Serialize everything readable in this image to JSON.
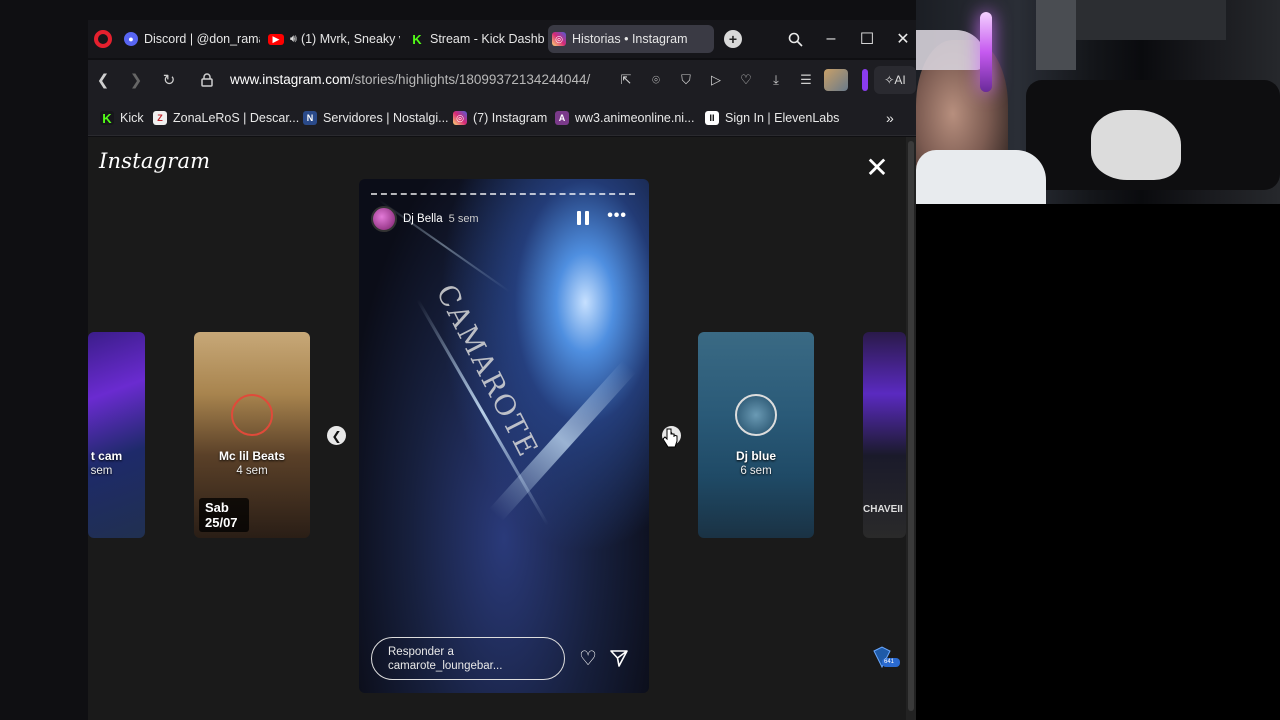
{
  "tabs": [
    {
      "label": "Discord | @don_rama",
      "icon": "discord-icon",
      "color": "#5865f2"
    },
    {
      "label": "(1) Mvrk, Sneaky v",
      "icon": "youtube-icon",
      "color": "#ff0000"
    },
    {
      "label": "Stream - Kick Dashbo",
      "icon": "kick-icon",
      "color": "#53fc18"
    },
    {
      "label": "Historias • Instagram",
      "icon": "instagram-icon",
      "color": "#d6249f",
      "active": true
    }
  ],
  "address": {
    "domain": "www.instagram.com",
    "path": "/stories/highlights/18099372134244044/"
  },
  "ai_label": "AI",
  "bookmarks": [
    {
      "label": "Kick",
      "icon": "kick-icon",
      "color": "#53fc18"
    },
    {
      "label": "ZonaLeRoS | Descar...",
      "icon": "zonaleros-icon",
      "color": "#e0e0e0"
    },
    {
      "label": "Servidores | Nostalgi...",
      "icon": "nostalgia-icon",
      "color": "#4a7bd0"
    },
    {
      "label": "(7) Instagram",
      "icon": "instagram-icon",
      "color": "#d6249f"
    },
    {
      "label": "ww3.animeonline.ni...",
      "icon": "anime-icon",
      "color": "#7a3a8a"
    },
    {
      "label": "Sign In | ElevenLabs",
      "icon": "elevenlabs-icon",
      "color": "#ffffff"
    }
  ],
  "instagram": {
    "logo": "Instagram",
    "side_stories": [
      {
        "name": "t cam",
        "time": "sem"
      },
      {
        "name": "Mc lil Beats",
        "time": "4 sem",
        "badge_day": "Sab",
        "badge_date": "25/07"
      },
      {
        "name": "Dj blue",
        "time": "6 sem"
      },
      {
        "name": "",
        "time": "",
        "overlay_text": "CHAVEII"
      }
    ],
    "main_story": {
      "user": "Dj Bella",
      "time": "5 sem",
      "overlay_text": "CAMAROTE",
      "reply_placeholder": "Responder a camarote_loungebar..."
    },
    "extension_badge": "641"
  }
}
